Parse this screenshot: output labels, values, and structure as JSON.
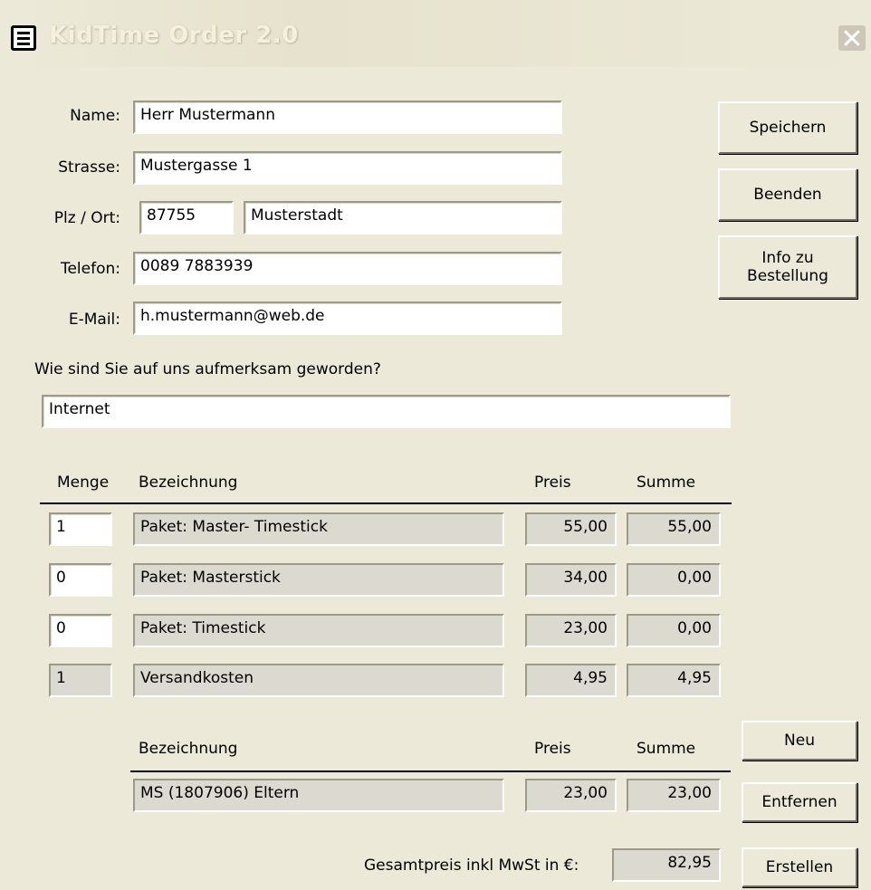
{
  "window": {
    "title": "KidTime Order 2.0",
    "close_glyph": "✕",
    "app_icon": "form-icon"
  },
  "form": {
    "name_label": "Name:",
    "name_value": "Herr  Mustermann",
    "strasse_label": "Strasse:",
    "strasse_value": "Mustergasse 1",
    "plzort_label": "Plz / Ort:",
    "plz_value": "87755",
    "ort_value": "Musterstadt",
    "telefon_label": "Telefon:",
    "telefon_value": "0089 7883939",
    "email_label": "E-Mail:",
    "email_value": "h.mustermann@web.de",
    "source_question": "Wie sind Sie auf uns aufmerksam geworden?",
    "source_value": "Internet"
  },
  "buttons": {
    "speichern": "Speichern",
    "beenden": "Beenden",
    "info_line1": "Info zu",
    "info_line2": "Bestellung",
    "neu": "Neu",
    "entfernen": "Entfernen",
    "erstellen": "Erstellen"
  },
  "products": {
    "headers": {
      "menge": "Menge",
      "bezeichnung": "Bezeichnung",
      "preis": "Preis",
      "summe": "Summe"
    },
    "rows": [
      {
        "menge": "1",
        "bezeichnung": "Paket: Master- Timestick",
        "preis": "55,00",
        "summe": "55,00"
      },
      {
        "menge": "0",
        "bezeichnung": "Paket: Masterstick",
        "preis": "34,00",
        "summe": "0,00"
      },
      {
        "menge": "0",
        "bezeichnung": "Paket: Timestick",
        "preis": "23,00",
        "summe": "0,00"
      },
      {
        "menge": "1",
        "bezeichnung": "Versandkosten",
        "preis": "4,95",
        "summe": "4,95"
      }
    ]
  },
  "extras": {
    "headers": {
      "bezeichnung": "Bezeichnung",
      "preis": "Preis",
      "summe": "Summe"
    },
    "rows": [
      {
        "bezeichnung": "MS (1807906) Eltern",
        "preis": "23,00",
        "summe": "23,00"
      }
    ]
  },
  "total": {
    "label": "Gesamtpreis inkl MwSt in €:",
    "value": "82,95"
  }
}
